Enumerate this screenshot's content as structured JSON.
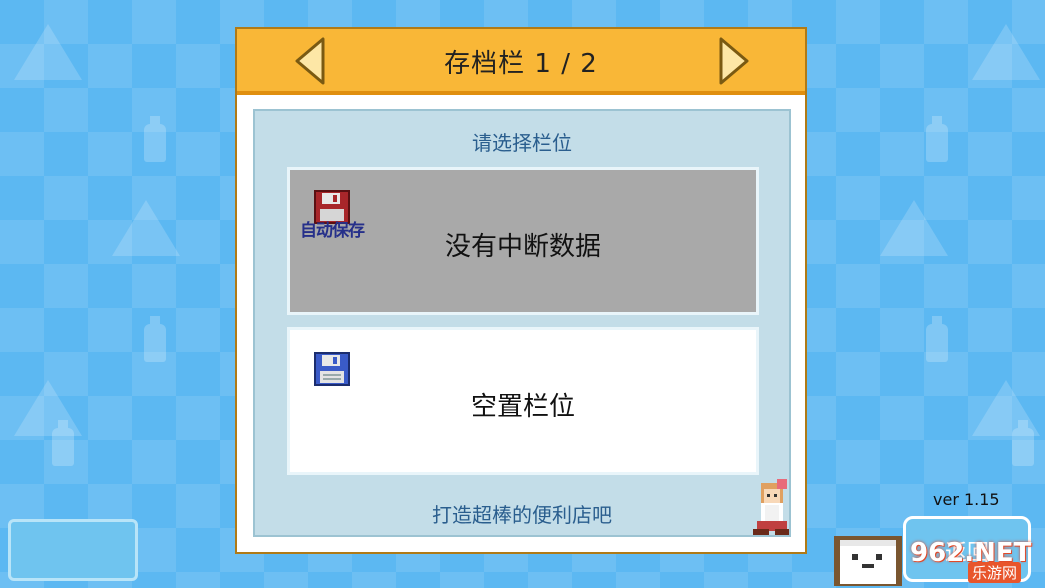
{
  "dialog": {
    "title": "存档栏 1 / 2",
    "caption": "请选择栏位",
    "slots": [
      {
        "label": "没有中断数据",
        "badge": "自动保存",
        "icon": "floppy-disk-red-icon",
        "state": "disabled"
      },
      {
        "label": "空置栏位",
        "icon": "floppy-disk-blue-icon",
        "state": "empty"
      }
    ],
    "footer": "打造超棒的便利店吧",
    "prev_icon": "chevron-left-icon",
    "next_icon": "chevron-right-icon"
  },
  "version": "ver 1.15",
  "back_button": {
    "label": "返回"
  },
  "watermark": {
    "brand": "962.NET",
    "sub": "乐游网"
  },
  "colors": {
    "header": "#f9b737",
    "panel": "#c3dde8",
    "slot_disabled": "#a9a9a9",
    "slot_empty": "#ffffff",
    "caption_text": "#2a5e8e",
    "background": "#5cb8f2"
  }
}
